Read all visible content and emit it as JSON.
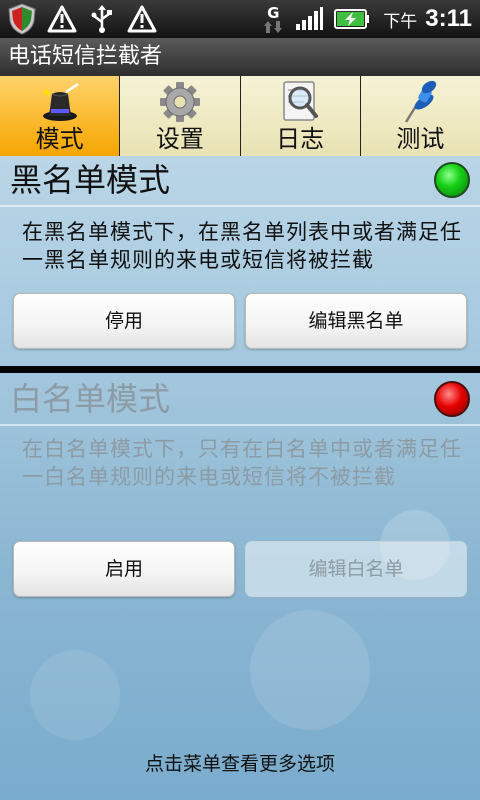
{
  "status_bar": {
    "network": "G",
    "ampm": "下午",
    "time": "3:11",
    "left_icons": [
      "shield-icon",
      "warning-icon",
      "usb-icon",
      "warning-icon"
    ],
    "right_icons": [
      "network-data-icon",
      "signal-icon",
      "battery-charging-icon"
    ]
  },
  "app": {
    "title": "电话短信拦截者"
  },
  "tabs": [
    {
      "label": "模式",
      "icon": "magic-hat-icon",
      "active": true
    },
    {
      "label": "设置",
      "icon": "gear-icon",
      "active": false
    },
    {
      "label": "日志",
      "icon": "log-magnifier-icon",
      "active": false
    },
    {
      "label": "测试",
      "icon": "pushpin-icon",
      "active": false
    }
  ],
  "blacklist": {
    "title": "黑名单模式",
    "status": "green",
    "description": "在黑名单模式下，在黑名单列表中或者满足任一黑名单规则的来电或短信将被拦截",
    "toggle_label": "停用",
    "edit_label": "编辑黑名单"
  },
  "whitelist": {
    "title": "白名单模式",
    "status": "red",
    "description": "在白名单模式下，只有在白名单中或者满足任一白名单规则的来电或短信将不被拦截",
    "toggle_label": "启用",
    "edit_label": "编辑白名单",
    "edit_disabled": true
  },
  "footer": {
    "hint": "点击菜单查看更多选项"
  },
  "colors": {
    "active_tab": "#f6a500",
    "tab_bg": "#efe9c4",
    "led_on": "#17d117",
    "led_off": "#e60000",
    "disabled_text": "#8d9ba4"
  }
}
